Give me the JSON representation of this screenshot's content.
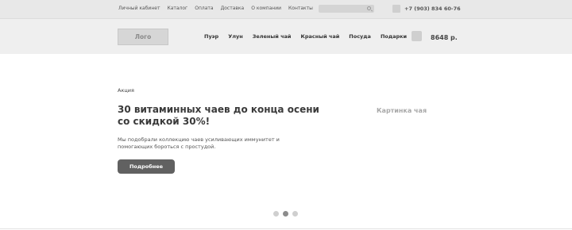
{
  "topbar": {
    "links": [
      "Личный кабинет",
      "Каталог",
      "Оплата",
      "Доставка",
      "О компании",
      "Контакты"
    ],
    "phone": "+7 (903) 834 60-76"
  },
  "header": {
    "logo": "Лого",
    "nav": [
      "Пуэр",
      "Улун",
      "Зеленый чай",
      "Красный чай",
      "Посуда",
      "Подарки"
    ],
    "cart_total": "8648 р."
  },
  "hero": {
    "label": "Акция",
    "title": "30 витаминных чаев до конца осени со скидкой 30%!",
    "description": "Мы подобрали коллекцию чаев усиливающих иммунитет и помогающих бороться с простудой.",
    "button": "Подробнее",
    "image_placeholder": "Картинка чая"
  },
  "slider": {
    "total": 3,
    "active_index": 1
  }
}
